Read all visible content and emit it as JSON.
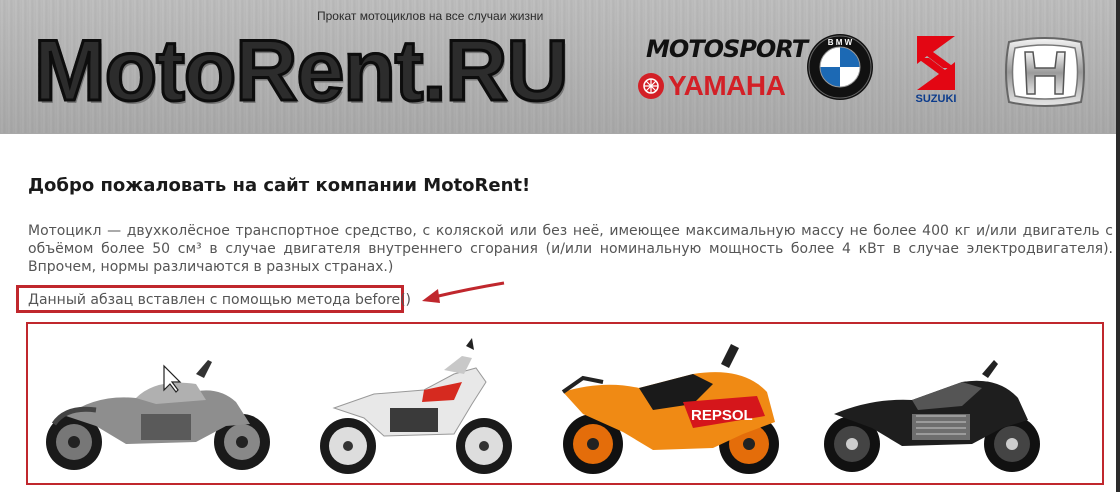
{
  "header": {
    "tagline": "Прокат мотоциклов на все случаи жизни",
    "logo_text": "MotoRent.RU",
    "brands": [
      {
        "name": "MOTOSPORT",
        "icon": "motosport-logo"
      },
      {
        "name": "YAMAHA",
        "icon": "yamaha-logo",
        "color": "#d32027"
      },
      {
        "name": "BMW",
        "icon": "bmw-logo"
      },
      {
        "name": "SUZUKI",
        "icon": "suzuki-logo",
        "color": "#e30613"
      },
      {
        "name": "HONDA",
        "icon": "honda-logo"
      }
    ]
  },
  "main": {
    "heading": "Добро пожаловать на сайт компании MotoRent!",
    "paragraph": "Мотоцикл — двухколёсное транспортное средство, с коляской или без неё, имеющее максимальную массу не более 400 кг и/или двигатель с объёмом более 50 см³ в случае двигателя внутреннего сгорания (и/или номинальную мощность более 4 кВт в случае электродвигателя). Впрочем, нормы различаются в разных странах.)",
    "inserted_paragraph": "Данный абзац вставлен с помощью метода before()"
  },
  "gallery": {
    "items": [
      {
        "icon": "cruiser-motorcycle-image"
      },
      {
        "icon": "enduro-motorcycle-image"
      },
      {
        "icon": "repsol-sportbike-image",
        "label": "REPSOL"
      },
      {
        "icon": "black-streetfighter-image"
      }
    ]
  },
  "colors": {
    "accent": "#c0272d",
    "text": "#555555",
    "heading": "#1a1a1a"
  }
}
